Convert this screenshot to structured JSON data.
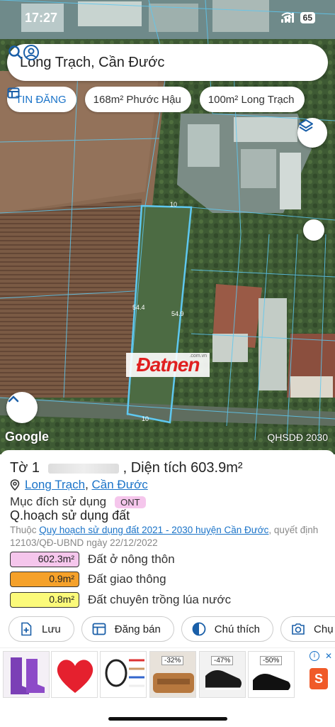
{
  "status_bar": {
    "time": "17:27",
    "battery": "65"
  },
  "search": {
    "query": "Long Trạch, Cần Đước"
  },
  "chips": [
    {
      "label": "TIN ĐĂNG"
    },
    {
      "label": "168m² Phước Hậu"
    },
    {
      "label": "100m² Long Trạch"
    }
  ],
  "map": {
    "edge_labels": [
      "10",
      "54.4",
      "54.9",
      "10"
    ],
    "watermark": "Đatnen",
    "watermark_small": ".com.vn",
    "google": "Google",
    "layer_name": "QHSDĐ 2030"
  },
  "parcel": {
    "title_prefix": "Tờ 1",
    "title_mid": "Thửa",
    "title_suffix": ", Diện tích 603.9m²",
    "ward": "Long Trạch",
    "separator": ", ",
    "district": "Cần Đước",
    "purpose_label": "Mục đích sử dụng",
    "purpose_code": "ONT",
    "plan_title": "Q.hoạch sử dụng đất",
    "plan_note_prefix": "Thuộc ",
    "plan_note_link": "Quy hoạch sử dụng đất 2021 - 2030 huyện Cần Đước",
    "plan_note_suffix": ", quyết định 12103/QĐ-UBND ngày 22/12/2022",
    "legend": [
      {
        "area": "602.3m²",
        "label": "Đất ở nông thôn",
        "color": "#f5c6ec"
      },
      {
        "area": "0.9m²",
        "label": "Đất giao thông",
        "color": "#f5a12a"
      },
      {
        "area": "0.8m²",
        "label": "Đất chuyên trồng lúa nước",
        "color": "#fbfa7a"
      }
    ]
  },
  "actions": [
    {
      "label": "Lưu",
      "icon": "save-icon"
    },
    {
      "label": "Đăng bán",
      "icon": "post-icon"
    },
    {
      "label": "Chú thích",
      "icon": "contrast-icon"
    },
    {
      "label": "Chụ",
      "icon": "camera-icon"
    }
  ],
  "ads": {
    "discounts": [
      "-32%",
      "-47%",
      "-50%"
    ],
    "shop_logo": "S",
    "close": "✕",
    "info": "i"
  },
  "colors": {
    "accent": "#1a73c8",
    "parcel_line": "#5ec8f0",
    "ont": "#f5c6ec",
    "road": "#f5a12a",
    "rice": "#fbfa7a"
  }
}
